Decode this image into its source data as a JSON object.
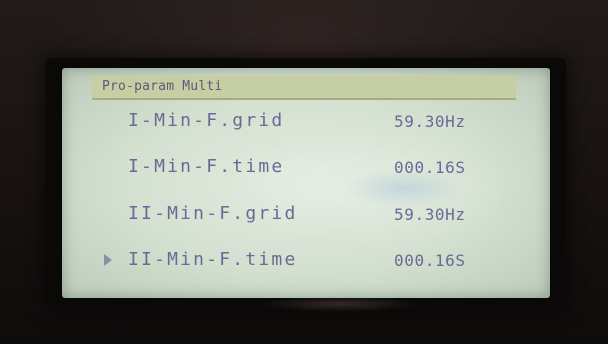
{
  "screen": {
    "title": "Pro-param Multi",
    "rows": [
      {
        "label": "I-Min-F.grid",
        "value": "59.30Hz",
        "selected": false
      },
      {
        "label": "I-Min-F.time",
        "value": "000.16S",
        "selected": false
      },
      {
        "label": "II-Min-F.grid",
        "value": "59.30Hz",
        "selected": false
      },
      {
        "label": "II-Min-F.time",
        "value": "000.16S",
        "selected": true
      }
    ],
    "cursor_icon": "right-triangle-icon"
  },
  "colors": {
    "lcd_background": "#d3e0d0",
    "header_background": "#c6cfa3",
    "text": "#6a6a96",
    "bezel": "#0b0908"
  }
}
